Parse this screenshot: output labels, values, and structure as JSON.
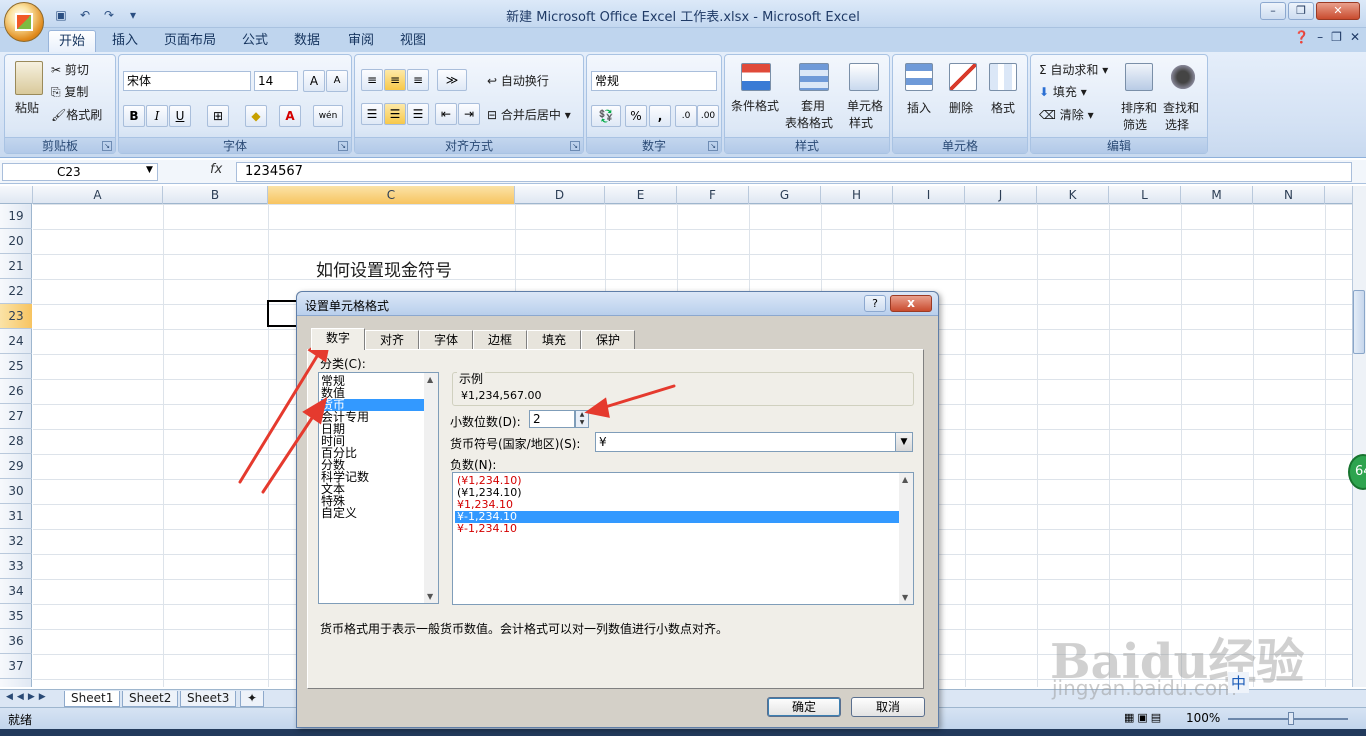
{
  "window": {
    "title": "新建 Microsoft Office Excel 工作表.xlsx - Microsoft Excel"
  },
  "ribbon_tabs": [
    "开始",
    "插入",
    "页面布局",
    "公式",
    "数据",
    "审阅",
    "视图"
  ],
  "clipboard": {
    "paste": "粘贴",
    "cut": "剪切",
    "copy": "复制",
    "format_painter": "格式刷",
    "label": "剪贴板"
  },
  "font": {
    "name": "宋体",
    "size": "14",
    "label": "字体",
    "bold": "B",
    "italic": "I",
    "underline": "U",
    "grow": "A",
    "shrink": "A",
    "text_color": "A",
    "phonetic": "wén"
  },
  "alignment": {
    "wrap": "自动换行",
    "merge": "合并后居中",
    "label": "对齐方式"
  },
  "number": {
    "format": "常规",
    "percent": "%",
    "comma": ",",
    "label": "数字"
  },
  "styles": {
    "conditional": "条件格式",
    "table_format": "套用",
    "table_format2": "表格格式",
    "cell_style": "单元格",
    "cell_style2": "样式",
    "label": "样式"
  },
  "cells": {
    "insert": "插入",
    "delete": "删除",
    "format": "格式",
    "label": "单元格"
  },
  "editing": {
    "autosum": "自动求和",
    "fill": "填充",
    "clear": "清除",
    "sort": "排序和",
    "sort2": "筛选",
    "find": "查找和",
    "find2": "选择",
    "label": "编辑"
  },
  "formula_bar": {
    "name_box": "C23",
    "fx": "fx",
    "content": "1234567"
  },
  "columns": [
    "A",
    "B",
    "C",
    "D",
    "E",
    "F",
    "G",
    "H",
    "I",
    "J",
    "K",
    "L",
    "M",
    "N"
  ],
  "rows": [
    "19",
    "20",
    "21",
    "22",
    "23",
    "24",
    "25",
    "26",
    "27",
    "28",
    "29",
    "30",
    "31",
    "32",
    "33",
    "34",
    "35",
    "36",
    "37"
  ],
  "cell_text": "如何设置现金符号",
  "sheets": [
    "Sheet1",
    "Sheet2",
    "Sheet3"
  ],
  "status": {
    "ready": "就绪",
    "zoom": "100%"
  },
  "dialog": {
    "title": "设置单元格格式",
    "help": "?",
    "close": "x",
    "tabs": [
      "数字",
      "对齐",
      "字体",
      "边框",
      "填充",
      "保护"
    ],
    "category_label": "分类(C):",
    "categories": [
      "常规",
      "数值",
      "货币",
      "会计专用",
      "日期",
      "时间",
      "百分比",
      "分数",
      "科学记数",
      "文本",
      "特殊",
      "自定义"
    ],
    "sample_label": "示例",
    "sample_value": "¥1,234,567.00",
    "decimal_label": "小数位数(D):",
    "decimal_value": "2",
    "symbol_label": "货币符号(国家/地区)(S):",
    "symbol_value": "¥",
    "negative_label": "负数(N):",
    "negative_options": [
      "(¥1,234.10)",
      "(¥1,234.10)",
      "¥1,234.10",
      "¥-1,234.10",
      "¥-1,234.10"
    ],
    "description": "货币格式用于表示一般货币数值。会计格式可以对一列数值进行小数点对齐。",
    "ok": "确定",
    "cancel": "取消"
  },
  "watermark": {
    "text": "Baidu经验",
    "sub": "jingyan.baidu.com"
  },
  "badge": "64",
  "ime": "中",
  "colors": {
    "accent": "#3399ff",
    "arrow": "#e53a2e",
    "header_selected": "#f7c461"
  }
}
